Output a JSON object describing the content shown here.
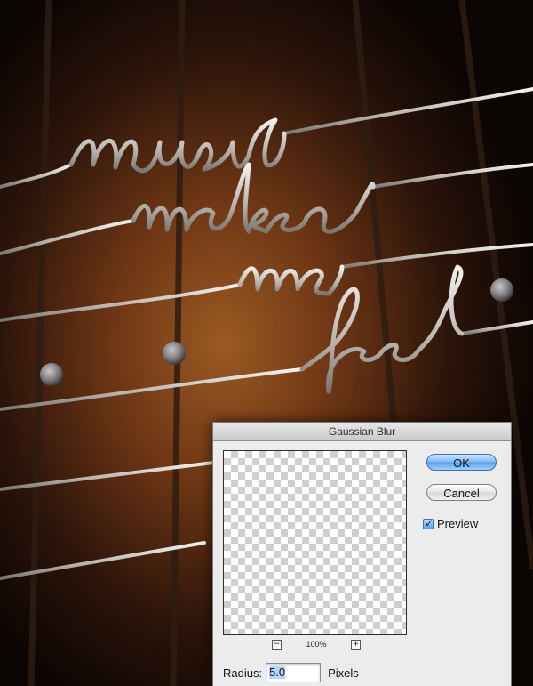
{
  "dialog": {
    "title": "Gaussian Blur",
    "ok_label": "OK",
    "cancel_label": "Cancel",
    "preview_label": "Preview",
    "preview_checked": true,
    "zoom_level": "100%",
    "zoom_out_symbol": "−",
    "zoom_in_symbol": "+",
    "radius_label": "Radius:",
    "radius_value": "5.0",
    "radius_unit": "Pixels"
  },
  "artwork": {
    "lettering": [
      "music",
      "makes",
      "me",
      "feel"
    ],
    "colors": {
      "wood_light": "#8a4a1c",
      "wood_dark": "#2a1309",
      "wire": "#d9d4cf",
      "fret": "#3a2619",
      "dot": "#8c8a8c"
    }
  },
  "icons": {
    "checkmark": "checkmark-icon"
  }
}
